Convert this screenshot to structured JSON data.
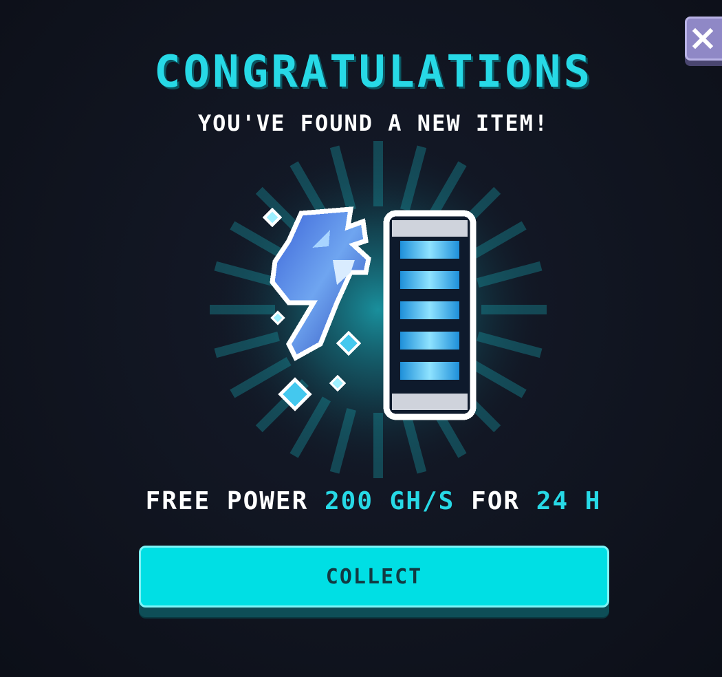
{
  "dialog": {
    "title": "Congratulations",
    "subtitle": "You've found a new item!",
    "reward": {
      "prefix": "Free power",
      "power": "200 Gh/s",
      "middle": "for",
      "duration": "24 h"
    },
    "collect_label": "Collect",
    "close_icon": "close-icon"
  },
  "item": {
    "icon": "power-battery-icon",
    "accent_color": "#27d9e6",
    "glow_color": "#1bb6c2"
  },
  "colors": {
    "background": "#10141f",
    "accent": "#27d9e6",
    "button": "#00dfe4",
    "close_button": "#8f88c6"
  }
}
